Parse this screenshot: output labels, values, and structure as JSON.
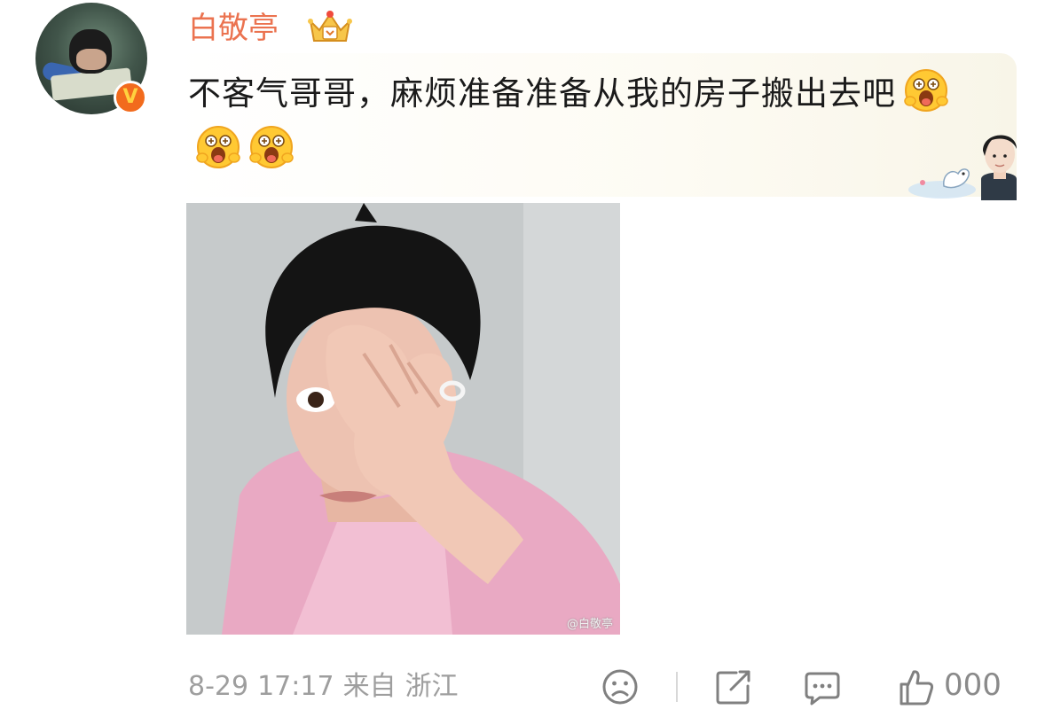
{
  "comment": {
    "username": "白敬亭",
    "text": "不客气哥哥，麻烦准备准备从我的房子搬出去吧",
    "emoji_count": 3,
    "emoji_icon": "shocked-face-emoji",
    "badge_letter": "V",
    "photo_watermark": "@白敬亭"
  },
  "meta": {
    "date": "8-29",
    "time": "17:17",
    "source_prefix": "来自",
    "location": "浙江"
  },
  "actions": {
    "like_count": "000"
  },
  "colors": {
    "username": "#eb7350",
    "badge": "#f26b1d",
    "meta": "#9e9e9e"
  }
}
